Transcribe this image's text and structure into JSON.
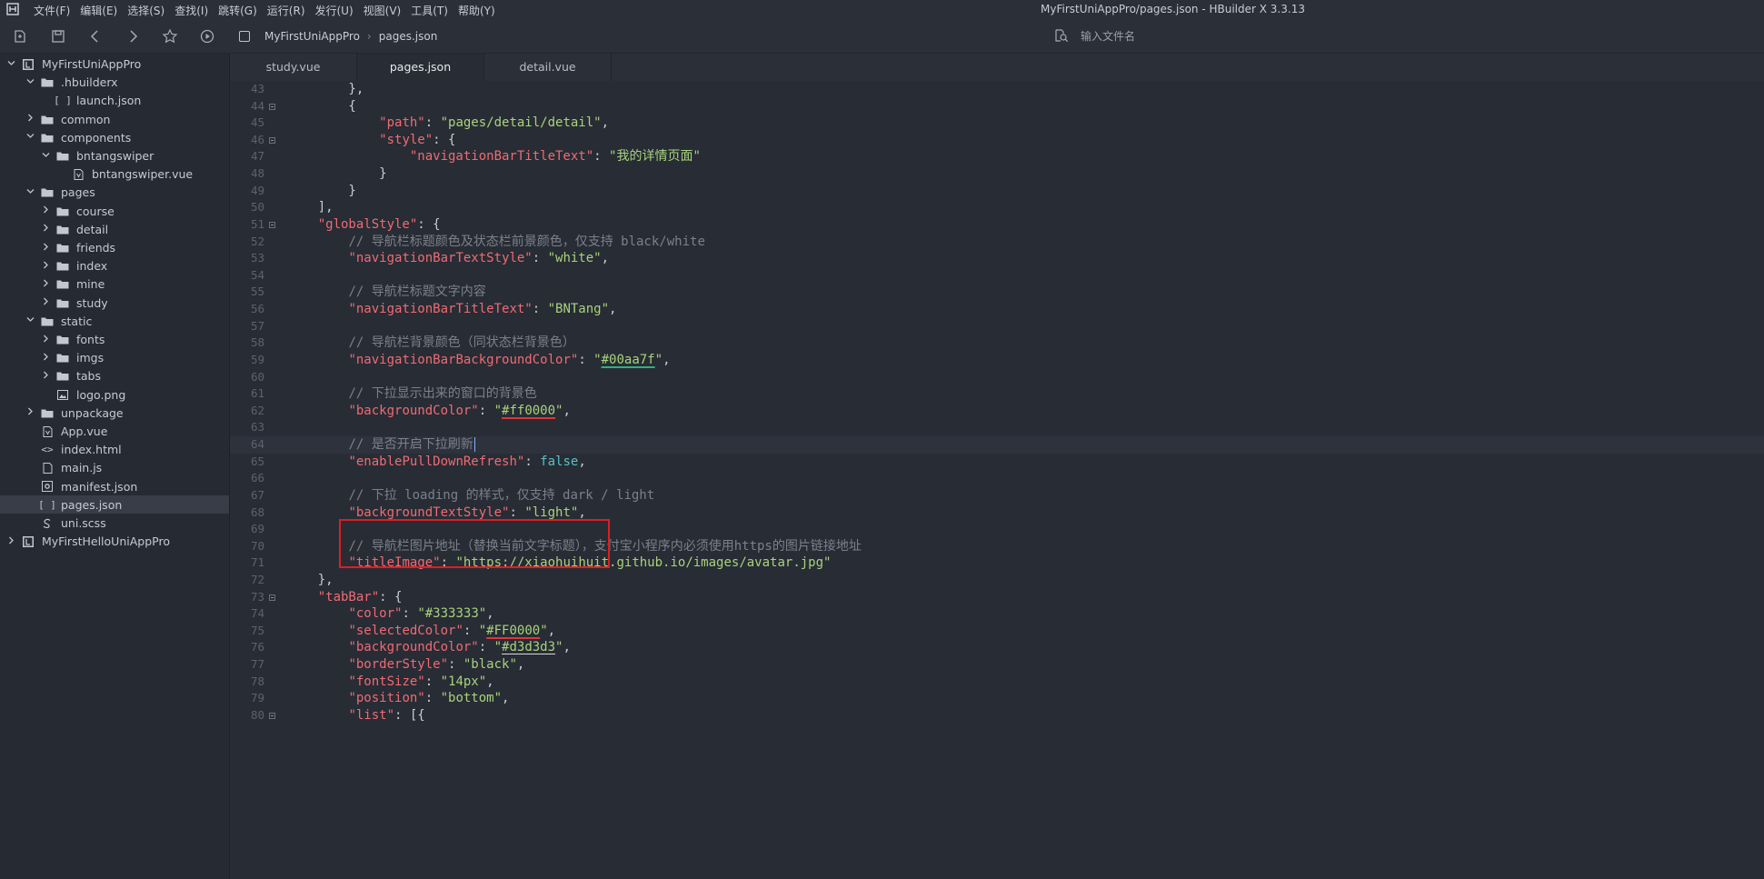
{
  "window": {
    "title": "MyFirstUniAppPro/pages.json - HBuilder X 3.3.13",
    "menus": [
      "文件(F)",
      "编辑(E)",
      "选择(S)",
      "查找(I)",
      "跳转(G)",
      "运行(R)",
      "发行(U)",
      "视图(V)",
      "工具(T)",
      "帮助(Y)"
    ]
  },
  "toolbar": {
    "icons": [
      "new-file-icon",
      "save-icon",
      "back-icon",
      "forward-icon",
      "star-icon",
      "run-icon"
    ],
    "breadcrumb": [
      "MyFirstUniAppPro",
      "pages.json"
    ],
    "file_search_placeholder": "输入文件名"
  },
  "tabs": [
    {
      "label": "study.vue",
      "active": false
    },
    {
      "label": "pages.json",
      "active": true
    },
    {
      "label": "detail.vue",
      "active": false
    }
  ],
  "sidebar": {
    "items": [
      {
        "label": "MyFirstUniAppPro",
        "depth": 0,
        "type": "project",
        "expanded": true
      },
      {
        "label": ".hbuilderx",
        "depth": 1,
        "type": "folder",
        "expanded": true
      },
      {
        "label": "launch.json",
        "depth": 2,
        "type": "json"
      },
      {
        "label": "common",
        "depth": 1,
        "type": "folder",
        "expanded": false
      },
      {
        "label": "components",
        "depth": 1,
        "type": "folder",
        "expanded": true
      },
      {
        "label": "bntangswiper",
        "depth": 2,
        "type": "folder",
        "expanded": true
      },
      {
        "label": "bntangswiper.vue",
        "depth": 3,
        "type": "vue"
      },
      {
        "label": "pages",
        "depth": 1,
        "type": "folder",
        "expanded": true
      },
      {
        "label": "course",
        "depth": 2,
        "type": "folder",
        "expanded": false
      },
      {
        "label": "detail",
        "depth": 2,
        "type": "folder",
        "expanded": false
      },
      {
        "label": "friends",
        "depth": 2,
        "type": "folder",
        "expanded": false
      },
      {
        "label": "index",
        "depth": 2,
        "type": "folder",
        "expanded": false
      },
      {
        "label": "mine",
        "depth": 2,
        "type": "folder",
        "expanded": false
      },
      {
        "label": "study",
        "depth": 2,
        "type": "folder",
        "expanded": false
      },
      {
        "label": "static",
        "depth": 1,
        "type": "folder",
        "expanded": true
      },
      {
        "label": "fonts",
        "depth": 2,
        "type": "folder",
        "expanded": false
      },
      {
        "label": "imgs",
        "depth": 2,
        "type": "folder",
        "expanded": false
      },
      {
        "label": "tabs",
        "depth": 2,
        "type": "folder",
        "expanded": false
      },
      {
        "label": "logo.png",
        "depth": 2,
        "type": "image"
      },
      {
        "label": "unpackage",
        "depth": 1,
        "type": "folder",
        "expanded": false
      },
      {
        "label": "App.vue",
        "depth": 1,
        "type": "vue"
      },
      {
        "label": "index.html",
        "depth": 1,
        "type": "html"
      },
      {
        "label": "main.js",
        "depth": 1,
        "type": "js"
      },
      {
        "label": "manifest.json",
        "depth": 1,
        "type": "manifest"
      },
      {
        "label": "pages.json",
        "depth": 1,
        "type": "json",
        "selected": true
      },
      {
        "label": "uni.scss",
        "depth": 1,
        "type": "scss"
      },
      {
        "label": "MyFirstHelloUniAppPro",
        "depth": 0,
        "type": "project",
        "expanded": false
      }
    ]
  },
  "editor": {
    "current_line": 64,
    "lines": [
      {
        "n": 43,
        "tokens": [
          [
            "p",
            "        },"
          ]
        ]
      },
      {
        "n": 44,
        "fold": true,
        "tokens": [
          [
            "p",
            "        {"
          ]
        ]
      },
      {
        "n": 45,
        "tokens": [
          [
            "p",
            "            "
          ],
          [
            "k",
            "\"path\""
          ],
          [
            "p",
            ": "
          ],
          [
            "s",
            "\"pages/detail/detail\""
          ],
          [
            "p",
            ","
          ]
        ]
      },
      {
        "n": 46,
        "fold": true,
        "tokens": [
          [
            "p",
            "            "
          ],
          [
            "k",
            "\"style\""
          ],
          [
            "p",
            ": {"
          ]
        ]
      },
      {
        "n": 47,
        "tokens": [
          [
            "p",
            "                "
          ],
          [
            "k",
            "\"navigationBarTitleText\""
          ],
          [
            "p",
            ": "
          ],
          [
            "s",
            "\"我的详情页面\""
          ]
        ]
      },
      {
        "n": 48,
        "tokens": [
          [
            "p",
            "            }"
          ]
        ]
      },
      {
        "n": 49,
        "tokens": [
          [
            "p",
            "        }"
          ]
        ]
      },
      {
        "n": 50,
        "tokens": [
          [
            "p",
            "    ],"
          ]
        ]
      },
      {
        "n": 51,
        "fold": true,
        "tokens": [
          [
            "p",
            "    "
          ],
          [
            "k",
            "\"globalStyle\""
          ],
          [
            "p",
            ": {"
          ]
        ]
      },
      {
        "n": 52,
        "tokens": [
          [
            "p",
            "        "
          ],
          [
            "c",
            "// 导航栏标题颜色及状态栏前景颜色，仅支持 black/white"
          ]
        ]
      },
      {
        "n": 53,
        "tokens": [
          [
            "p",
            "        "
          ],
          [
            "k",
            "\"navigationBarTextStyle\""
          ],
          [
            "p",
            ": "
          ],
          [
            "s",
            "\"white\""
          ],
          [
            "p",
            ","
          ]
        ]
      },
      {
        "n": 54,
        "tokens": []
      },
      {
        "n": 55,
        "tokens": [
          [
            "p",
            "        "
          ],
          [
            "c",
            "// 导航栏标题文字内容"
          ]
        ]
      },
      {
        "n": 56,
        "tokens": [
          [
            "p",
            "        "
          ],
          [
            "k",
            "\"navigationBarTitleText\""
          ],
          [
            "p",
            ": "
          ],
          [
            "s",
            "\"BNTang\""
          ],
          [
            "p",
            ","
          ]
        ]
      },
      {
        "n": 57,
        "tokens": []
      },
      {
        "n": 58,
        "tokens": [
          [
            "p",
            "        "
          ],
          [
            "c",
            "// 导航栏背景颜色（同状态栏背景色）"
          ]
        ]
      },
      {
        "n": 59,
        "tokens": [
          [
            "p",
            "        "
          ],
          [
            "k",
            "\"navigationBarBackgroundColor\""
          ],
          [
            "p",
            ": "
          ],
          [
            "s",
            "\""
          ],
          [
            "s u-green",
            "#00aa7f"
          ],
          [
            "s",
            "\""
          ],
          [
            "p",
            ","
          ]
        ]
      },
      {
        "n": 60,
        "tokens": []
      },
      {
        "n": 61,
        "tokens": [
          [
            "p",
            "        "
          ],
          [
            "c",
            "// 下拉显示出来的窗口的背景色"
          ]
        ]
      },
      {
        "n": 62,
        "tokens": [
          [
            "p",
            "        "
          ],
          [
            "k",
            "\"backgroundColor\""
          ],
          [
            "p",
            ": "
          ],
          [
            "s",
            "\""
          ],
          [
            "s u-red",
            "#ff0000"
          ],
          [
            "s",
            "\""
          ],
          [
            "p",
            ","
          ]
        ]
      },
      {
        "n": 63,
        "tokens": []
      },
      {
        "n": 64,
        "caret": true,
        "tokens": [
          [
            "p",
            "        "
          ],
          [
            "c",
            "// 是否开启下拉刷新"
          ]
        ]
      },
      {
        "n": 65,
        "tokens": [
          [
            "p",
            "        "
          ],
          [
            "k",
            "\"enablePullDownRefresh\""
          ],
          [
            "p",
            ": "
          ],
          [
            "b",
            "false"
          ],
          [
            "p",
            ","
          ]
        ]
      },
      {
        "n": 66,
        "tokens": []
      },
      {
        "n": 67,
        "tokens": [
          [
            "p",
            "        "
          ],
          [
            "c",
            "// 下拉 loading 的样式，仅支持 dark / light"
          ]
        ]
      },
      {
        "n": 68,
        "tokens": [
          [
            "p",
            "        "
          ],
          [
            "k",
            "\"backgroundTextStyle\""
          ],
          [
            "p",
            ": "
          ],
          [
            "s",
            "\"light\""
          ],
          [
            "p",
            ","
          ]
        ]
      },
      {
        "n": 69,
        "tokens": []
      },
      {
        "n": 70,
        "tokens": [
          [
            "p",
            "        "
          ],
          [
            "c",
            "// 导航栏图片地址（替换当前文字标题），支付宝小程序内必须使用https的图片链接地址"
          ]
        ]
      },
      {
        "n": 71,
        "tokens": [
          [
            "p",
            "        "
          ],
          [
            "k",
            "\"titleImage\""
          ],
          [
            "p",
            ": "
          ],
          [
            "s",
            "\"https://xiaohuihuit.github.io/images/avatar.jpg\""
          ]
        ]
      },
      {
        "n": 72,
        "tokens": [
          [
            "p",
            "    },"
          ]
        ]
      },
      {
        "n": 73,
        "fold": true,
        "tokens": [
          [
            "p",
            "    "
          ],
          [
            "k",
            "\"tabBar\""
          ],
          [
            "p",
            ": {"
          ]
        ]
      },
      {
        "n": 74,
        "tokens": [
          [
            "p",
            "        "
          ],
          [
            "k",
            "\"color\""
          ],
          [
            "p",
            ": "
          ],
          [
            "s",
            "\"#333333\""
          ],
          [
            "p",
            ","
          ]
        ]
      },
      {
        "n": 75,
        "tokens": [
          [
            "p",
            "        "
          ],
          [
            "k",
            "\"selectedColor\""
          ],
          [
            "p",
            ": "
          ],
          [
            "s",
            "\""
          ],
          [
            "s u-red",
            "#FF0000"
          ],
          [
            "s",
            "\""
          ],
          [
            "p",
            ","
          ]
        ]
      },
      {
        "n": 76,
        "tokens": [
          [
            "p",
            "        "
          ],
          [
            "k",
            "\"backgroundColor\""
          ],
          [
            "p",
            ": "
          ],
          [
            "s",
            "\""
          ],
          [
            "s u-white",
            "#d3d3d3"
          ],
          [
            "s",
            "\""
          ],
          [
            "p",
            ","
          ]
        ]
      },
      {
        "n": 77,
        "tokens": [
          [
            "p",
            "        "
          ],
          [
            "k",
            "\"borderStyle\""
          ],
          [
            "p",
            ": "
          ],
          [
            "s",
            "\"black\""
          ],
          [
            "p",
            ","
          ]
        ]
      },
      {
        "n": 78,
        "tokens": [
          [
            "p",
            "        "
          ],
          [
            "k",
            "\"fontSize\""
          ],
          [
            "p",
            ": "
          ],
          [
            "s",
            "\"14px\""
          ],
          [
            "p",
            ","
          ]
        ]
      },
      {
        "n": 79,
        "tokens": [
          [
            "p",
            "        "
          ],
          [
            "k",
            "\"position\""
          ],
          [
            "p",
            ": "
          ],
          [
            "s",
            "\"bottom\""
          ],
          [
            "p",
            ","
          ]
        ]
      },
      {
        "n": 80,
        "fold": true,
        "tokens": [
          [
            "p",
            "        "
          ],
          [
            "k",
            "\"list\""
          ],
          [
            "p",
            ": [{"
          ]
        ]
      }
    ]
  }
}
